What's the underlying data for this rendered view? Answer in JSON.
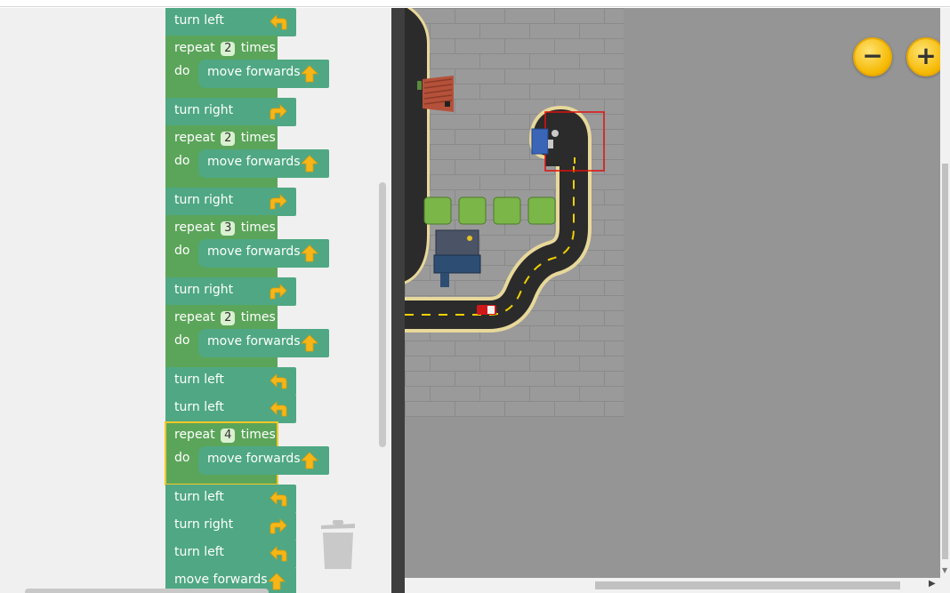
{
  "program_blocks": [
    {
      "type": "turn",
      "label": "turn left",
      "dir": "left"
    },
    {
      "type": "repeat",
      "times": "2",
      "prefix": "repeat",
      "suffix": "times",
      "do": "do",
      "inner": "move forwards"
    },
    {
      "type": "turn",
      "label": "turn right",
      "dir": "right"
    },
    {
      "type": "repeat",
      "times": "2",
      "prefix": "repeat",
      "suffix": "times",
      "do": "do",
      "inner": "move forwards"
    },
    {
      "type": "turn",
      "label": "turn right",
      "dir": "right"
    },
    {
      "type": "repeat",
      "times": "3",
      "prefix": "repeat",
      "suffix": "times",
      "do": "do",
      "inner": "move forwards"
    },
    {
      "type": "turn",
      "label": "turn right",
      "dir": "right"
    },
    {
      "type": "repeat",
      "times": "2",
      "prefix": "repeat",
      "suffix": "times",
      "do": "do",
      "inner": "move forwards"
    },
    {
      "type": "turn",
      "label": "turn left",
      "dir": "left"
    },
    {
      "type": "turn",
      "label": "turn left",
      "dir": "left"
    },
    {
      "type": "repeat",
      "times": "4",
      "prefix": "repeat",
      "suffix": "times",
      "do": "do",
      "inner": "move forwards",
      "selected": true
    },
    {
      "type": "turn",
      "label": "turn left",
      "dir": "left"
    },
    {
      "type": "turn",
      "label": "turn right",
      "dir": "right"
    },
    {
      "type": "turn",
      "label": "turn left",
      "dir": "left"
    },
    {
      "type": "move",
      "label": "move forwards"
    }
  ],
  "map": {
    "zoom_out_label": "−",
    "zoom_in_label": "+"
  },
  "colors": {
    "turn_block": "#4fa883",
    "repeat_block": "#5ba55a",
    "selected_outline": "#f6c827",
    "map_background": "#959595",
    "road": "#2b2b2b",
    "road_edge": "#e8d89a",
    "lane_marking": "#f0d000",
    "destination_box": "#e01010",
    "car": "#d01818"
  },
  "icons": [
    "turn-left-arrow-icon",
    "turn-right-arrow-icon",
    "move-forwards-arrow-icon",
    "trash-icon",
    "zoom-out-icon",
    "zoom-in-icon"
  ]
}
